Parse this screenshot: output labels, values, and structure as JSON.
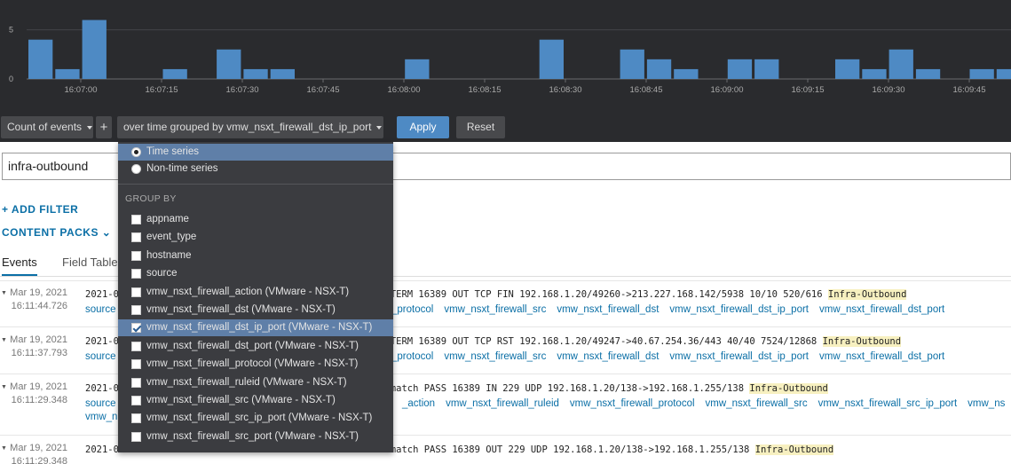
{
  "chart_data": {
    "type": "bar",
    "y_ticks": [
      "5",
      "0"
    ],
    "ylim": [
      0,
      6.5
    ],
    "x_tick_labels": [
      "16:07:00",
      "16:07:15",
      "16:07:30",
      "16:07:45",
      "16:08:00",
      "16:08:15",
      "16:08:30",
      "16:08:45",
      "16:09:00",
      "16:09:15",
      "16:09:30",
      "16:09:45"
    ],
    "bar_interval_seconds": 5,
    "values": [
      4,
      1,
      6,
      0,
      0,
      1,
      0,
      3,
      1,
      1,
      0,
      0,
      0,
      0,
      2,
      0,
      0,
      0,
      0,
      4,
      0,
      0,
      3,
      2,
      1,
      0,
      2,
      2,
      0,
      0,
      2,
      1,
      3,
      1,
      0,
      1,
      1
    ],
    "bar_color": "#4e8ac4",
    "grid": true
  },
  "toolbar": {
    "count_label": "Count of events",
    "add_label": "+",
    "group_label": "over time grouped by vmw_nsxt_firewall_dst_ip_port",
    "apply_label": "Apply",
    "reset_label": "Reset"
  },
  "query": {
    "value": "infra-outbound"
  },
  "filters": {
    "add_filter": "+ ADD FILTER",
    "content_packs": "CONTENT PACKS ⌄"
  },
  "tabs": {
    "events": "Events",
    "field_table": "Field Table"
  },
  "dropdown": {
    "series_options": [
      {
        "label": "Time series",
        "selected": true
      },
      {
        "label": "Non-time series",
        "selected": false
      }
    ],
    "group_by_header": "GROUP BY",
    "group_by_options": [
      {
        "label": "appname",
        "checked": false
      },
      {
        "label": "event_type",
        "checked": false
      },
      {
        "label": "hostname",
        "checked": false
      },
      {
        "label": "source",
        "checked": false
      },
      {
        "label": "vmw_nsxt_firewall_action (VMware - NSX-T)",
        "checked": false
      },
      {
        "label": "vmw_nsxt_firewall_dst (VMware - NSX-T)",
        "checked": false
      },
      {
        "label": "vmw_nsxt_firewall_dst_ip_port (VMware - NSX-T)",
        "checked": true
      },
      {
        "label": "vmw_nsxt_firewall_dst_port (VMware - NSX-T)",
        "checked": false
      },
      {
        "label": "vmw_nsxt_firewall_protocol (VMware - NSX-T)",
        "checked": false
      },
      {
        "label": "vmw_nsxt_firewall_ruleid (VMware - NSX-T)",
        "checked": false
      },
      {
        "label": "vmw_nsxt_firewall_src (VMware - NSX-T)",
        "checked": false
      },
      {
        "label": "vmw_nsxt_firewall_src_ip_port (VMware - NSX-T)",
        "checked": false
      },
      {
        "label": "vmw_nsxt_firewall_src_port (VMware - NSX-T)",
        "checked": false
      }
    ]
  },
  "events": [
    {
      "date": "Mar 19, 2021",
      "time": "16:11:44.726",
      "text_prefix": "2021-0",
      "text_visible": "ac02ff INET TERM 16389 OUT TCP FIN 192.168.1.20/49260->213.227.168.142/5938 10/10 520/616 ",
      "highlight": "Infra-Outbound",
      "fields_left": [
        "source"
      ],
      "fields_right": [
        "_protocol",
        "vmw_nsxt_firewall_src",
        "vmw_nsxt_firewall_dst",
        "vmw_nsxt_firewall_dst_ip_port",
        "vmw_nsxt_firewall_dst_port"
      ]
    },
    {
      "date": "Mar 19, 2021",
      "time": "16:11:37.793",
      "text_prefix": "2021-0",
      "text_visible": "ac02ff INET TERM 16389 OUT TCP RST 192.168.1.20/49247->40.67.254.36/443 40/40 7524/12868 ",
      "highlight": "Infra-Outbound",
      "fields_left": [
        "source"
      ],
      "fields_right": [
        "_protocol",
        "vmw_nsxt_firewall_src",
        "vmw_nsxt_firewall_dst",
        "vmw_nsxt_firewall_dst_ip_port",
        "vmw_nsxt_firewall_dst_port"
      ]
    },
    {
      "date": "Mar 19, 2021",
      "time": "16:11:29.348",
      "text_prefix": "2021-0",
      "text_visible": "ab2de5 INET match PASS 16389 IN 229 UDP 192.168.1.20/138->192.168.1.255/138 ",
      "highlight": "Infra-Outbound",
      "fields_left": [
        "source",
        "vmw_n"
      ],
      "fields_right": [
        "_action",
        "vmw_nsxt_firewall_ruleid",
        "vmw_nsxt_firewall_protocol",
        "vmw_nsxt_firewall_src",
        "vmw_nsxt_firewall_src_ip_port",
        "vmw_ns"
      ]
    },
    {
      "date": "Mar 19, 2021",
      "time": "16:11:29.348",
      "text_prefix": "2021-0",
      "text_visible": "ac02ff INET match PASS 16389 OUT 229 UDP 192.168.1.20/138->192.168.1.255/138 ",
      "highlight": "Infra-Outbound"
    }
  ]
}
